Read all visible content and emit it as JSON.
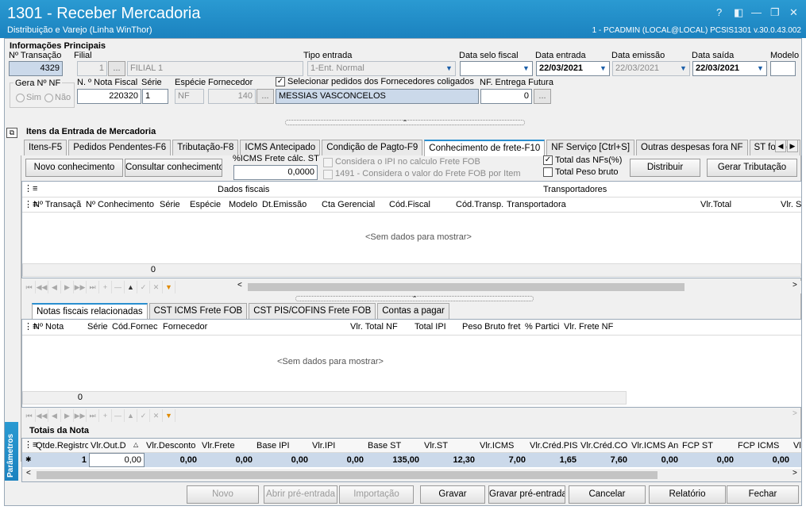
{
  "window": {
    "title": "1301 - Receber Mercadoria",
    "subtitle": "Distribuição e Varejo (Linha WinThor)",
    "info": "1 - PCADMIN  (LOCAL@LOCAL)   PCSIS1301  v.30.0.43.002",
    "help": "?",
    "minimize": "—",
    "restore": "❐",
    "close": "✕",
    "icon_app": "◧"
  },
  "info_principais": {
    "title": "Informações Principais",
    "lbl_transacao": "Nº Transação",
    "transacao": "4329",
    "lbl_filial": "Filial",
    "filial_cod": "1",
    "filial_btn": "...",
    "filial_nome": "FILIAL 1",
    "lbl_tipo": "Tipo entrada",
    "tipo": "1-Ent. Normal",
    "lbl_data_selo": "Data selo fiscal",
    "lbl_data_entrada": "Data entrada",
    "data_entrada": "22/03/2021",
    "lbl_data_emissao": "Data emissão",
    "data_emissao": "22/03/2021",
    "lbl_data_saida": "Data saída",
    "data_saida": "22/03/2021",
    "lbl_modelo": "Modelo",
    "lbl_gera_nf": "Gera Nº NF",
    "sim": "Sim",
    "nao": "Não",
    "lbl_nota": "N. º Nota Fiscal",
    "nota": "220320",
    "lbl_serie": "Série",
    "serie": "1",
    "lbl_especie": "Espécie",
    "especie": "NF",
    "lbl_fornecedor": "Fornecedor",
    "fornecedor_cod": "140",
    "fornecedor_btn": "...",
    "fornecedor_nome": "MESSIAS VASCONCELOS",
    "selecionar_pedidos": "Selecionar pedidos dos Fornecedores coligados",
    "lbl_nf_entrega": "NF. Entrega Futura",
    "nf_entrega": "0",
    "nf_entrega_btn": "..."
  },
  "itens": {
    "title": "Itens da Entrada de Mercadoria",
    "tabs": [
      "Itens-F5",
      "Pedidos Pendentes-F6",
      "Tributação-F8",
      "ICMS Antecipado",
      "Condição de Pagto-F9",
      "Conhecimento de frete-F10",
      "NF Serviço [Ctrl+S]",
      "Outras despesas fora NF",
      "ST fora da N"
    ],
    "btn_novo": "Novo conhecimento",
    "btn_consultar": "Consultar conhecimento",
    "lbl_icms_frete": "%ICMS Frete cálc. ST",
    "icms_frete": "0,0000",
    "chk_ipi": "Considera o IPI no calculo Frete FOB",
    "chk_1491": "1491 - Considera o valor do Frete FOB por Item",
    "chk_total_nfs": "Total das NFs(%)",
    "chk_total_peso": "Total Peso bruto",
    "btn_distribuir": "Distribuir",
    "btn_gerar": "Gerar Tributação"
  },
  "grid1": {
    "band_fiscais": "Dados fiscais",
    "band_transp": "Transportadores",
    "columns": [
      "Nº Transaçã",
      "Nº Conhecimento",
      "Série",
      "Espécie",
      "Modelo",
      "Dt.Emissão",
      "Cta Gerencial",
      "Cód.Fiscal",
      "Cód.Transp.",
      "Transportadora",
      "Vlr.Total",
      "Vlr. S"
    ],
    "empty": "<Sem dados para mostrar>",
    "count": "0"
  },
  "tabs2": [
    "Notas fiscais relacionadas",
    "CST ICMS Frete FOB",
    "CST PIS/COFINS Frete FOB",
    "Contas a pagar"
  ],
  "grid2": {
    "columns": [
      "Nº Nota",
      "Série",
      "Cód.Fornec",
      "Fornecedor",
      "Vlr. Total NF",
      "Total IPI",
      "Peso Bruto fret",
      "% Partici",
      "Vlr. Frete NF"
    ],
    "empty": "<Sem dados para mostrar>",
    "count": "0"
  },
  "totais": {
    "title": "Totais da Nota",
    "columns": [
      "Qtde.Registro",
      "Vlr.Out.D",
      "Vlr.Desconto",
      "Vlr.Frete",
      "Base IPI",
      "Vlr.IPI",
      "Base ST",
      "Vlr.ST",
      "Vlr.ICMS",
      "Vlr.Créd.PIS",
      "Vlr.Créd.CO",
      "Vlr.ICMS An",
      "FCP ST",
      "FCP ICMS",
      "Vl"
    ],
    "values": [
      "1",
      "0,00",
      "0,00",
      "0,00",
      "0,00",
      "0,00",
      "135,00",
      "12,30",
      "7,00",
      "1,65",
      "7,60",
      "0,00",
      "0,00",
      "0,00",
      ""
    ]
  },
  "side_tab": "Parâmetros",
  "bottom_buttons": {
    "novo": "Novo",
    "abrir": "Abrir pré-entrada",
    "importacao": "Importação",
    "gravar": "Gravar",
    "gravar_pre": "Gravar pré-entrada",
    "cancelar": "Cancelar",
    "relatorio": "Relatório",
    "fechar": "Fechar"
  },
  "colors": {
    "titlebar": "#1b82bf",
    "accent": "#2a8fd0",
    "grid_blue": "#cbd9ea"
  }
}
